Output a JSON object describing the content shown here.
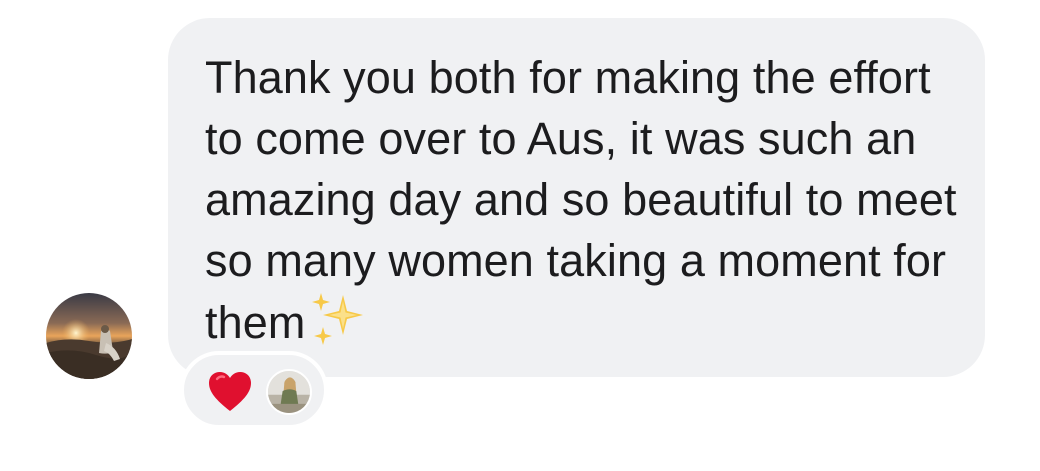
{
  "message": {
    "text": "Thank you both for making the effort to come over to Aus, it was such an amazing day and so beautiful to meet so many women taking a moment for them",
    "trailing_icon": "sparkles-emoji"
  },
  "sender": {
    "avatar_icon": "sunset-photo-avatar"
  },
  "reactions": {
    "items": [
      {
        "icon": "red-heart-emoji",
        "color": "#e0102f"
      },
      {
        "icon": "reactor-profile-avatar"
      }
    ]
  },
  "colors": {
    "bubble_bg": "#f0f1f3",
    "text": "#1c1c1e",
    "page_bg": "#ffffff"
  }
}
